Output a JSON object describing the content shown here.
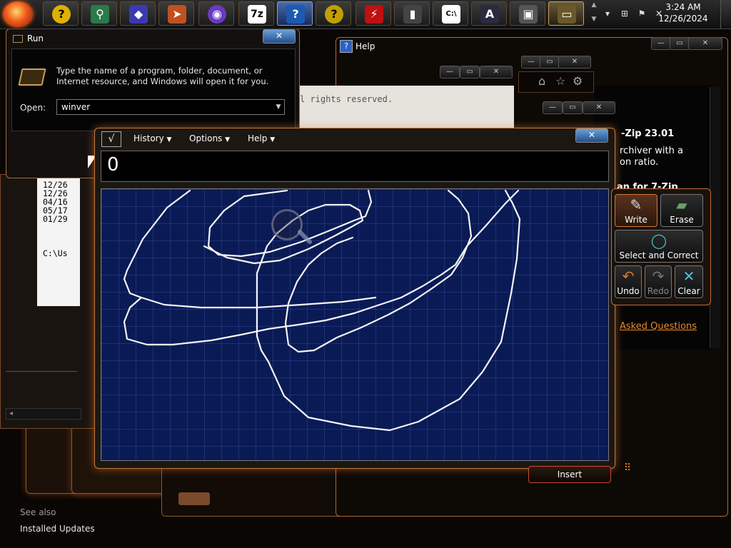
{
  "taskbar": {
    "apps": [
      {
        "icon": "help-icon",
        "glyph": "?",
        "color": "#e0b000"
      },
      {
        "icon": "magnifier-icon",
        "glyph": "⚲",
        "color": "#2a7a4a"
      },
      {
        "icon": "cube-icon",
        "glyph": "◆",
        "color": "#3a3ab0"
      },
      {
        "icon": "paper-plane-icon",
        "glyph": "➤",
        "color": "#c05020"
      },
      {
        "icon": "windows-media-icon",
        "glyph": "◉",
        "color": "#6a3ac0"
      },
      {
        "icon": "seven-zip-icon",
        "glyph": "7z",
        "color": "#222222"
      },
      {
        "icon": "help-support-icon",
        "glyph": "?",
        "color": "#1a5ab0"
      },
      {
        "icon": "narrator-icon",
        "glyph": "?",
        "color": "#c0a000"
      },
      {
        "icon": "flash-icon",
        "glyph": "⚡",
        "color": "#c01010"
      },
      {
        "icon": "mobile-icon",
        "glyph": "▮",
        "color": "#444444"
      },
      {
        "icon": "command-prompt-icon",
        "glyph": "C:\\",
        "color": "#000000"
      },
      {
        "icon": "math-input-icon",
        "glyph": "A",
        "color": "#2a2a40"
      },
      {
        "icon": "projector-icon",
        "glyph": "▣",
        "color": "#555555"
      },
      {
        "icon": "run-icon",
        "glyph": "▭",
        "color": "#6a5a2a"
      }
    ],
    "clock": {
      "time": "3:24 AM",
      "date": "12/26/2024"
    }
  },
  "run_dialog": {
    "title": "Run",
    "description": "Type the name of a program, folder, document, or Internet resource, and Windows will open it for you.",
    "open_label": "Open:",
    "input_value": "winver"
  },
  "help_window": {
    "title": "Help",
    "lines": [
      "-Zip 23.01",
      "rchiver with a",
      "on ratio.",
      "an for 7-Zip"
    ],
    "rights_text": "l rights reserved.",
    "faq_link": "Asked Questions"
  },
  "cmd_window": {
    "lines": [
      "12/26",
      "12/26",
      "04/16",
      "05/17",
      "01/29",
      "",
      "C:\\Us"
    ]
  },
  "control_panel": {
    "see_also": "See also",
    "installed_updates": "Installed Updates"
  },
  "math_input_panel": {
    "menus": [
      {
        "label": "History"
      },
      {
        "label": "Options"
      },
      {
        "label": "Help"
      }
    ],
    "preview": "0",
    "tools": [
      {
        "label": "Write",
        "state": "active",
        "icon": "pen-icon",
        "glyph": "✎"
      },
      {
        "label": "Erase",
        "state": "normal",
        "icon": "eraser-icon",
        "glyph": "▰"
      },
      {
        "label": "Select and Correct",
        "state": "normal",
        "icon": "lasso-icon",
        "glyph": "◯"
      },
      {
        "label": "Undo",
        "state": "normal",
        "icon": "undo-icon",
        "glyph": "↶"
      },
      {
        "label": "Redo",
        "state": "disabled",
        "icon": "redo-icon",
        "glyph": "↷"
      },
      {
        "label": "Clear",
        "state": "normal",
        "icon": "clear-icon",
        "glyph": "✕"
      }
    ],
    "insert_label": "Insert"
  },
  "colors": {
    "accent": "#c87a3a",
    "canvas": "#0a1a55",
    "link": "#e88a2a"
  }
}
